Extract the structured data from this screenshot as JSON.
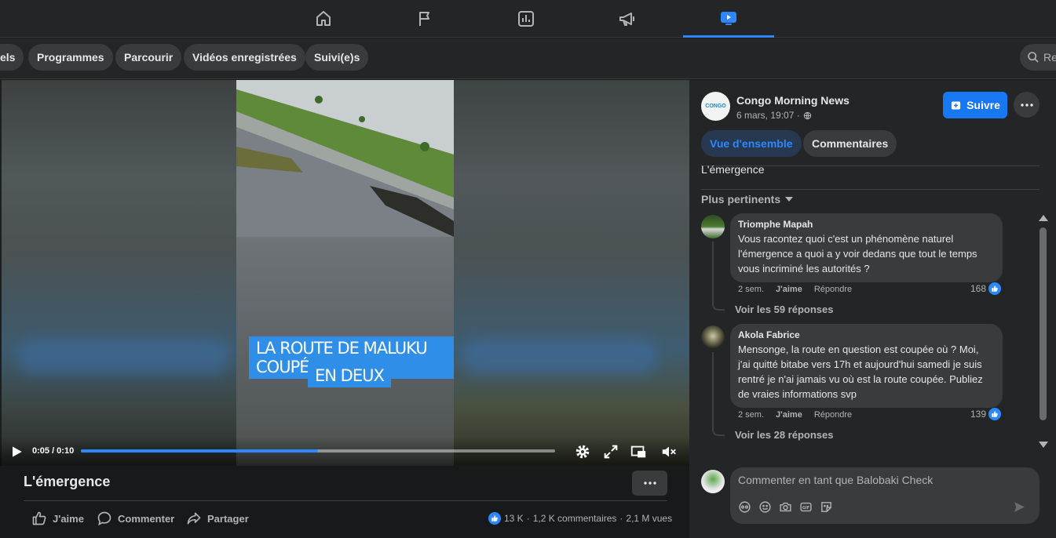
{
  "nav": {
    "items": [
      {
        "name": "home-icon",
        "active": false
      },
      {
        "name": "flag-icon",
        "active": false
      },
      {
        "name": "chart-icon",
        "active": false
      },
      {
        "name": "megaphone-icon",
        "active": false
      },
      {
        "name": "video-icon",
        "active": true
      }
    ]
  },
  "tabs": {
    "items": [
      "els",
      "Programmes",
      "Parcourir",
      "Vidéos enregistrées",
      "Suivi(e)s"
    ],
    "search_text": "Re"
  },
  "video": {
    "caption_line1": "LA ROUTE DE MALUKU COUPÉ",
    "caption_line2": "EN DEUX",
    "time": "0:05 / 0:10",
    "progress": 0.5,
    "title": "L'émergence"
  },
  "actions": {
    "like": "J'aime",
    "comment": "Commenter",
    "share": "Partager"
  },
  "stats": {
    "likes": "13 K",
    "dot1": "·",
    "comments": "1,2 K commentaires",
    "dot2": "·",
    "views": "2,1 M vues"
  },
  "post": {
    "page_name": "Congo Morning News",
    "logo_text": "CONGO",
    "date": "6 mars, 19:07 ·",
    "follow_label": "Suivre",
    "tab_overview": "Vue d'ensemble",
    "tab_comments": "Commentaires",
    "description": "L'émergence",
    "sort_label": "Plus pertinents"
  },
  "comments": [
    {
      "author": "Triomphe Mapah",
      "text": "Vous racontez quoi c'est un phénomène naturel l'émergence a quoi a y voir dedans que tout le temps vous incriminé les autorités ?",
      "time": "2 sem.",
      "like": "J'aime",
      "reply": "Répondre",
      "count": "168",
      "replies": "Voir les 59 réponses"
    },
    {
      "author": "Akola Fabrice",
      "text": "Mensonge, la route en question est coupée où ? Moi, j'ai quitté bitabe vers 17h et aujourd'hui samedi je suis rentré je n'ai jamais vu où est la route coupée. Publiez de vraies informations svp",
      "time": "2 sem.",
      "like": "J'aime",
      "reply": "Répondre",
      "count": "139",
      "replies": "Voir les 28 réponses"
    }
  ],
  "composer": {
    "placeholder": "Commenter en tant que Balobaki Check"
  },
  "colors": {
    "accent": "#2d88ff",
    "follow": "#1877f2",
    "caption": "#2f8fe8"
  }
}
